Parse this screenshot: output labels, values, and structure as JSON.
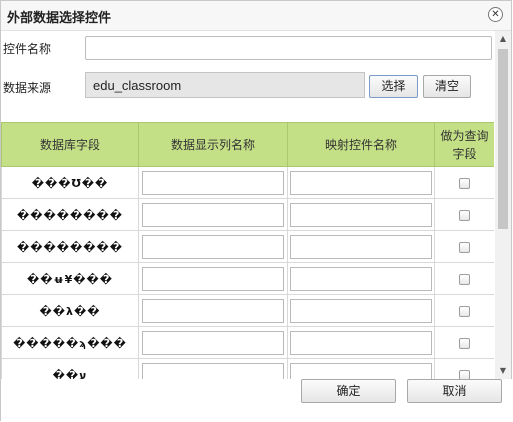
{
  "dialog": {
    "title": "外部数据选择控件",
    "close_icon": "close-icon"
  },
  "form": {
    "control_name_label": "控件名称",
    "control_name_value": "",
    "data_source_label": "数据来源",
    "data_source_value": "edu_classroom",
    "select_button": "选择",
    "clear_button": "清空"
  },
  "table": {
    "headers": [
      "数据库字段",
      "数据显示列名称",
      "映射控件名称",
      "做为查询字段"
    ],
    "rows": [
      {
        "field": "���Ʊ��"
      },
      {
        "field": "��������"
      },
      {
        "field": "��������"
      },
      {
        "field": "��ʉ¥���"
      },
      {
        "field": "��λ��"
      },
      {
        "field": "�����ϡ���"
      },
      {
        "field": "��ע"
      }
    ]
  },
  "footer": {
    "ok_button": "确定",
    "cancel_button": "取消"
  },
  "colors": {
    "header_bg": "#c4e087",
    "header_border": "#a9c870"
  }
}
